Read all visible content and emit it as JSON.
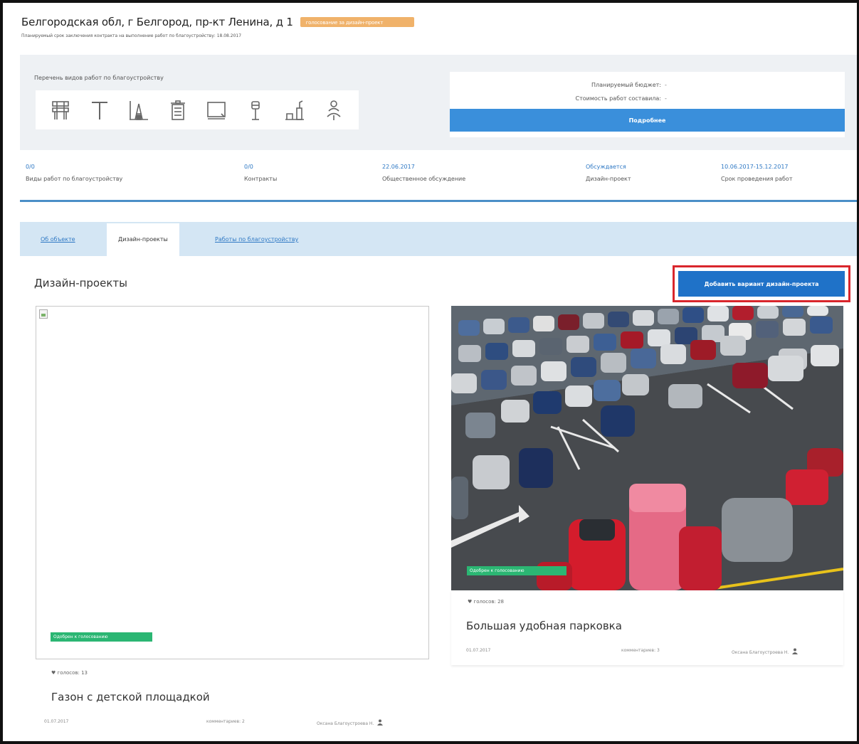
{
  "header": {
    "title": "Белгородская обл, г Белгород, пр-кт Ленина, д 1",
    "badge": "голосование за дизайн-проект",
    "subtitle": "Планируемый срок заключения контракта на выполнение работ по благоустройству: 18.08.2017"
  },
  "works": {
    "label": "Перечень видов работ по благоустройству",
    "icons": [
      "bench-icon",
      "text-t-icon",
      "playground-icon",
      "trash-bin-icon",
      "frame-icon",
      "lamp-icon",
      "fountain-icon",
      "tree-icon"
    ]
  },
  "budget": {
    "planned_label": "Планируемый бюджет:",
    "planned_value": "-",
    "cost_label": "Стоимость работ составила:",
    "cost_value": "-",
    "details_button": "Подробнее"
  },
  "stats": [
    {
      "value": "0/0",
      "label": "Виды работ по благоустройству"
    },
    {
      "value": "0/0",
      "label": "Контракты"
    },
    {
      "value": "22.06.2017",
      "label": "Общественное обсуждение"
    },
    {
      "value": "Обсуждается",
      "label": "Дизайн-проект"
    },
    {
      "value": "10.06.2017-15.12.2017",
      "label": "Срок проведения работ"
    }
  ],
  "tabs": {
    "about": "Об объекте",
    "design": "Дизайн-проекты",
    "works": "Работы по благоустройству"
  },
  "section": {
    "title": "Дизайн-проекты",
    "add_button": "Добавить вариант дизайн-проекта"
  },
  "cards": [
    {
      "status": "Одобрен к голосованию",
      "votes": "голосов: 13",
      "title": "Газон с детской площадкой",
      "date": "01.07.2017",
      "comments": "комментариев: 2",
      "author": "Оксана Благоустроева Н."
    },
    {
      "status": "Одобрен к голосованию",
      "votes": "голосов: 28",
      "title": "Большая удобная парковка",
      "date": "01.07.2017",
      "comments": "комментариев: 3",
      "author": "Оксана Благоустроева Н."
    }
  ],
  "colors": {
    "accent_blue": "#1f72c8",
    "light_blue": "#3a8fdb",
    "tab_bg": "#d4e6f4",
    "badge_orange": "#f0b26a",
    "status_green": "#2bb673",
    "highlight_red": "#d9262c"
  }
}
